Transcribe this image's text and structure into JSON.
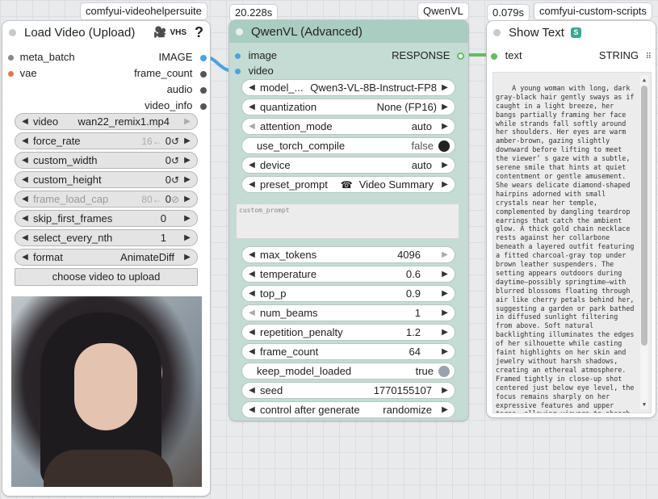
{
  "badges": {
    "load_video": "comfyui-videohelpersuite",
    "qwen_time": "20.228s",
    "qwen_pack": "QwenVL",
    "show_time": "0.079s",
    "show_pack": "comfyui-custom-scripts"
  },
  "load_video": {
    "title": "Load Video (Upload)",
    "tag_icon": "camera-icon",
    "tag_text": "VHS",
    "help": "?",
    "inputs": [
      {
        "label": "meta_batch",
        "color": "#888888"
      },
      {
        "label": "vae",
        "color": "#e07a4a"
      }
    ],
    "outputs": [
      {
        "label": "IMAGE",
        "color": "#4aa3df"
      },
      {
        "label": "frame_count",
        "color": "#555555"
      },
      {
        "label": "audio",
        "color": "#555555"
      },
      {
        "label": "video_info",
        "color": "#555555"
      }
    ],
    "widgets": [
      {
        "label": "video",
        "value": "wan22_remix1.mp4",
        "hint": ""
      },
      {
        "label": "force_rate",
        "value": "0",
        "hint": "16←",
        "icon": "↺"
      },
      {
        "label": "custom_width",
        "value": "0",
        "hint": "",
        "icon": "↺"
      },
      {
        "label": "custom_height",
        "value": "0",
        "hint": "",
        "icon": "↺"
      },
      {
        "label": "frame_load_cap",
        "value": "0",
        "hint": "80←",
        "icon": "⊘"
      },
      {
        "label": "skip_first_frames",
        "value": "0",
        "hint": ""
      },
      {
        "label": "select_every_nth",
        "value": "1",
        "hint": ""
      },
      {
        "label": "format",
        "value": "AnimateDiff",
        "hint": ""
      }
    ],
    "upload_button": "choose video to upload"
  },
  "qwen": {
    "title": "QwenVL (Advanced)",
    "inputs": [
      {
        "label": "image",
        "color": "#4aa3df"
      },
      {
        "label": "video",
        "color": "#4aa3df"
      }
    ],
    "output": {
      "label": "RESPONSE",
      "color": "#5fbf5f"
    },
    "widgets_top": [
      {
        "label": "model_...",
        "value": "Qwen3-VL-8B-Instruct-FP8",
        "kind": "combo"
      },
      {
        "label": "quantization",
        "value": "None (FP16)",
        "kind": "combo"
      },
      {
        "label": "attention_mode",
        "value": "auto",
        "kind": "combo"
      },
      {
        "label": "use_torch_compile",
        "value": "false",
        "kind": "toggle-on"
      },
      {
        "label": "device",
        "value": "auto",
        "kind": "combo"
      },
      {
        "label": "preset_prompt",
        "value": "Video Summary",
        "kind": "combo",
        "icon": "☎"
      }
    ],
    "custom_prompt_placeholder": "custom_prompt",
    "widgets_bottom": [
      {
        "label": "max_tokens",
        "value": "4096",
        "kind": "number"
      },
      {
        "label": "temperature",
        "value": "0.6",
        "kind": "number"
      },
      {
        "label": "top_p",
        "value": "0.9",
        "kind": "number"
      },
      {
        "label": "num_beams",
        "value": "1",
        "kind": "number"
      },
      {
        "label": "repetition_penalty",
        "value": "1.2",
        "kind": "number"
      },
      {
        "label": "frame_count",
        "value": "64",
        "kind": "number"
      },
      {
        "label": "keep_model_loaded",
        "value": "true",
        "kind": "toggle-off"
      },
      {
        "label": "seed",
        "value": "1770155107",
        "kind": "number"
      },
      {
        "label": "control after generate",
        "value": "randomize",
        "kind": "combo"
      }
    ]
  },
  "show_text": {
    "title": "Show Text",
    "title_icon": "python-snake-icon",
    "input": {
      "label": "text",
      "color": "#5fbf5f"
    },
    "output": {
      "label": "STRING",
      "icon": "grid-dots-icon"
    },
    "text": "A young woman with long, dark gray-black hair gently sways as if caught in a light breeze, her bangs partially framing her face while strands fall softly around her shoulders. Her eyes are warm amber-brown, gazing slightly downward before lifting to meet the viewer’ s gaze with a subtle, serene smile that hints at quiet contentment or gentle amusement. She wears delicate diamond-shaped hairpins adorned with small crystals near her temple, complemented by dangling teardrop earrings that catch the ambient glow. A thick gold chain necklace rests against her collarbone beneath a layered outfit featuring a fitted charcoal-gray top under brown leather suspenders. The setting appears outdoors during daytime—possibly springtime—with blurred blossoms floating through air like cherry petals behind her, suggesting a garden or park bathed in diffused sunlight filtering from above. Soft natural backlighting illuminates the edges of her silhouette while casting faint highlights on her skin and jewelry without harsh shadows, creating an ethereal atmosphere. Framed tightly in close-up shot centered just below eye level, the focus remains sharply on her expressive features and upper torso, allowing viewers to absorb"
  }
}
